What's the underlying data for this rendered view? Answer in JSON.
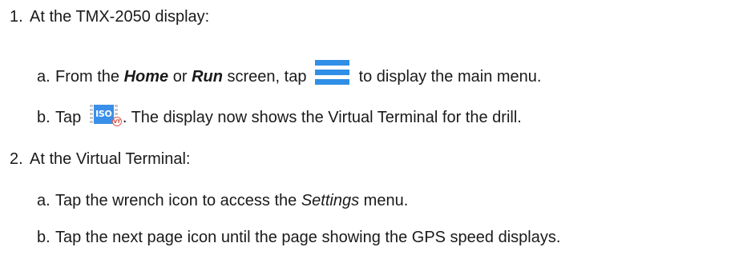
{
  "step1": {
    "number": "1.",
    "text": "At the TMX-2050 display:",
    "a": {
      "letter": "a.",
      "t1": "From the ",
      "home": "Home",
      "t2": " or ",
      "run": "Run",
      "t3": " screen, tap ",
      "icon": "menu-icon",
      "t4": " to display the main menu."
    },
    "b": {
      "letter": "b.",
      "t1": "Tap ",
      "icon": "iso-vt-icon",
      "icon_label": "ISO",
      "icon_badge": "VT",
      "t2": ". The display now shows the Virtual Terminal for the drill."
    }
  },
  "step2": {
    "number": "2.",
    "text": "At the Virtual Terminal:",
    "a": {
      "letter": "a.",
      "t1": "Tap the wrench icon to access the ",
      "settings": "Settings",
      "t2": " menu."
    },
    "b": {
      "letter": "b.",
      "text": "Tap the next page icon until the page showing the GPS speed displays."
    }
  },
  "colors": {
    "icon_blue": "#2f8fe6",
    "badge_red": "#d33a2a",
    "text": "#1a1a1a"
  }
}
